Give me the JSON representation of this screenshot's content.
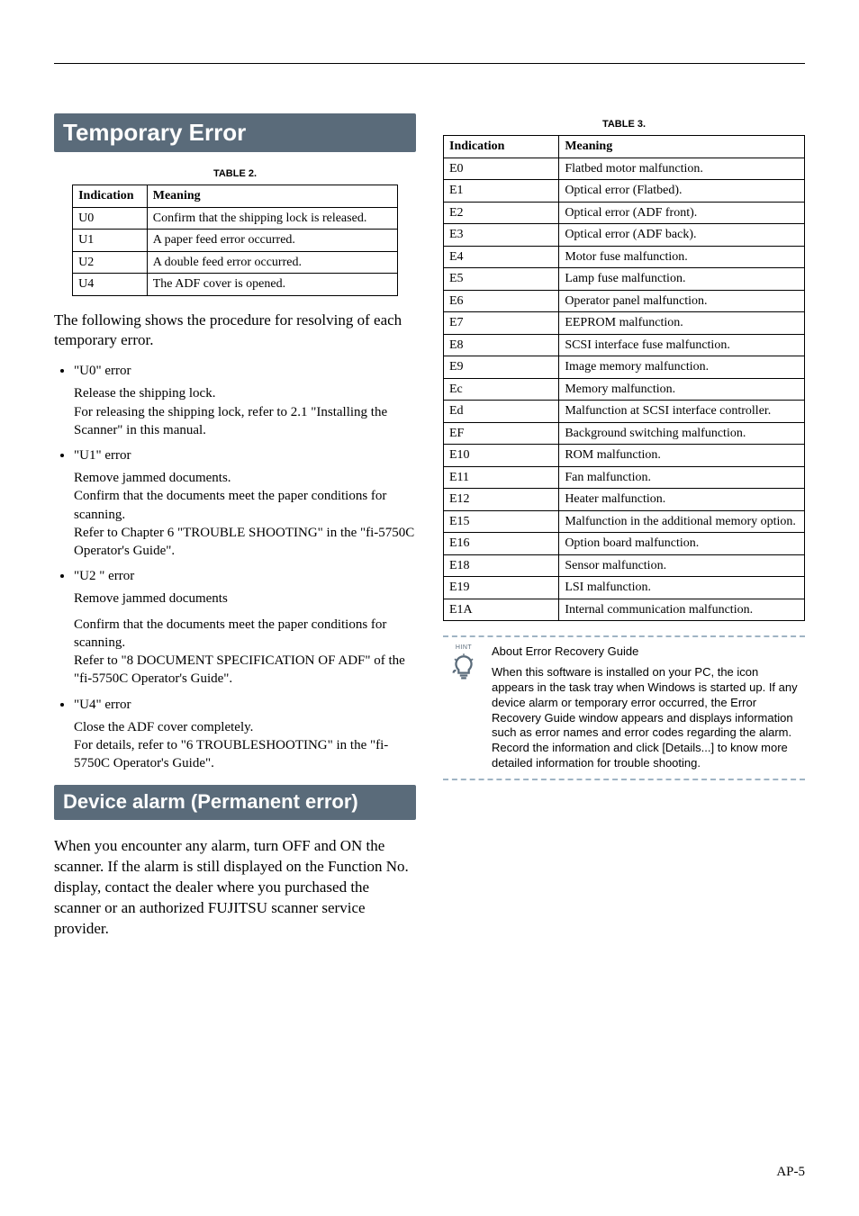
{
  "left": {
    "heading1": "Temporary Error",
    "table2_caption": "TABLE 2.",
    "table2_headers": [
      "Indication",
      "Meaning"
    ],
    "table2_rows": [
      {
        "ind": "U0",
        "mean": "Confirm that the shipping lock is released."
      },
      {
        "ind": "U1",
        "mean": "A paper feed error occurred."
      },
      {
        "ind": "U2",
        "mean": "A double feed error occurred."
      },
      {
        "ind": "U4",
        "mean": "The ADF cover is opened."
      }
    ],
    "intro": "The following shows the procedure for resolving of each temporary error.",
    "errors": [
      {
        "title": "\"U0\" error",
        "paras": [
          "Release the shipping lock.\nFor releasing the shipping lock, refer to 2.1 \"Installing the Scanner\" in this manual."
        ]
      },
      {
        "title": "\"U1\" error",
        "paras": [
          "Remove jammed documents.\nConfirm that the documents meet the paper conditions for scanning.\nRefer to Chapter 6 \"TROUBLE SHOOTING\" in the \"fi-5750C Operator's Guide\"."
        ]
      },
      {
        "title": "\"U2 \" error",
        "paras": [
          "Remove jammed documents",
          "Confirm that the documents meet the paper conditions for scanning.\nRefer to \"8 DOCUMENT SPECIFICATION OF ADF\" of the \"fi-5750C Operator's Guide\"."
        ]
      },
      {
        "title": "\"U4\" error",
        "paras": [
          "Close the ADF cover completely.\nFor details, refer to \"6 TROUBLESHOOTING\" in the \"fi-5750C Operator's Guide\"."
        ]
      }
    ],
    "heading2": "Device alarm (Permanent error)",
    "alarm_body": "When you encounter any alarm, turn OFF and ON the scanner. If the alarm is still displayed on the Function No. display, contact the dealer where you purchased the scanner or an authorized FUJITSU scanner service provider."
  },
  "right": {
    "table3_caption": "TABLE 3.",
    "table3_headers": [
      "Indication",
      "Meaning"
    ],
    "table3_rows": [
      {
        "ind": "E0",
        "mean": "Flatbed motor malfunction."
      },
      {
        "ind": "E1",
        "mean": "Optical error (Flatbed)."
      },
      {
        "ind": "E2",
        "mean": "Optical error (ADF front)."
      },
      {
        "ind": "E3",
        "mean": "Optical error (ADF back)."
      },
      {
        "ind": "E4",
        "mean": "Motor fuse malfunction."
      },
      {
        "ind": "E5",
        "mean": "Lamp fuse malfunction."
      },
      {
        "ind": "E6",
        "mean": "Operator panel malfunction."
      },
      {
        "ind": "E7",
        "mean": "EEPROM malfunction."
      },
      {
        "ind": "E8",
        "mean": "SCSI interface fuse malfunction."
      },
      {
        "ind": "E9",
        "mean": "Image memory malfunction."
      },
      {
        "ind": "Ec",
        "mean": "Memory malfunction."
      },
      {
        "ind": "Ed",
        "mean": "Malfunction at SCSI interface controller."
      },
      {
        "ind": "EF",
        "mean": "Background switching malfunction."
      },
      {
        "ind": "E10",
        "mean": "ROM malfunction."
      },
      {
        "ind": "E11",
        "mean": "Fan malfunction."
      },
      {
        "ind": "E12",
        "mean": "Heater malfunction."
      },
      {
        "ind": "E15",
        "mean": "Malfunction in the additional memory option."
      },
      {
        "ind": "E16",
        "mean": "Option board malfunction."
      },
      {
        "ind": "E18",
        "mean": "Sensor malfunction."
      },
      {
        "ind": "E19",
        "mean": "LSI malfunction."
      },
      {
        "ind": "E1A",
        "mean": "Internal communication malfunction."
      }
    ],
    "hint_label": "HINT",
    "hint_title": "About Error Recovery Guide",
    "hint_body": "When this software is installed on your PC, the icon appears in the task tray when Windows is started up. If any device alarm or temporary error occurred, the Error Recovery Guide window appears and displays information such as error names and error codes regarding the alarm. Record the information and click [Details...] to know more detailed information for trouble shooting."
  },
  "page_number": "AP-5"
}
